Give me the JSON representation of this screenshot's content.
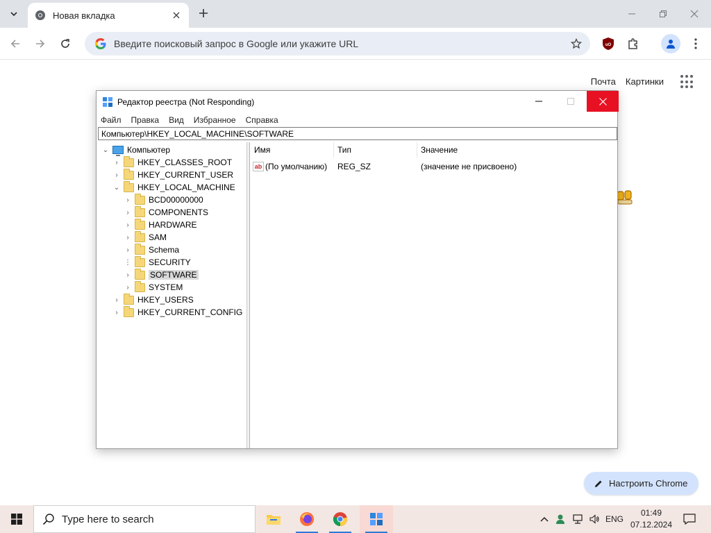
{
  "browser": {
    "tab": {
      "title": "Новая вкладка"
    },
    "omnibox": {
      "placeholder": "Введите поисковый запрос в Google или укажите URL"
    },
    "icons": {
      "tab_search": "chevron-down-icon",
      "new_tab": "plus-icon",
      "back": "arrow-left-icon",
      "forward": "arrow-right-icon",
      "reload": "reload-icon",
      "bookmark": "star-icon",
      "ublock": "ublock-origin-icon",
      "extensions": "puzzle-icon",
      "profile": "person-icon",
      "menu": "kebab-menu-icon"
    }
  },
  "ntp": {
    "links": [
      "Почта",
      "Картинки"
    ],
    "customize_label": "Настроить Chrome"
  },
  "regedit": {
    "title": "Редактор реестра (Not Responding)",
    "menu": [
      "Файл",
      "Правка",
      "Вид",
      "Избранное",
      "Справка"
    ],
    "address": "Компьютер\\HKEY_LOCAL_MACHINE\\SOFTWARE",
    "tree": {
      "root": "Компьютер",
      "hives": [
        "HKEY_CLASSES_ROOT",
        "HKEY_CURRENT_USER",
        "HKEY_LOCAL_MACHINE"
      ],
      "hklm_children": [
        "BCD00000000",
        "COMPONENTS",
        "HARDWARE",
        "SAM",
        "Schema",
        "SECURITY",
        "SOFTWARE",
        "SYSTEM"
      ],
      "hives_after": [
        "HKEY_USERS",
        "HKEY_CURRENT_CONFIG"
      ],
      "selected": "SOFTWARE"
    },
    "columns": [
      "Имя",
      "Тип",
      "Значение"
    ],
    "rows": [
      {
        "name": "(По умолчанию)",
        "type": "REG_SZ",
        "value": "(значение не присвоено)"
      }
    ]
  },
  "taskbar": {
    "search_placeholder": "Type here to search",
    "apps": [
      "file-explorer-icon",
      "firefox-icon",
      "chrome-icon",
      "regedit-icon"
    ],
    "language": "ENG",
    "time": "01:49",
    "date": "07.12.2024"
  },
  "colors": {
    "close_red": "#e81123",
    "customize_bg": "#d3e3fd",
    "taskbar_bg": "#f3e7e4"
  }
}
